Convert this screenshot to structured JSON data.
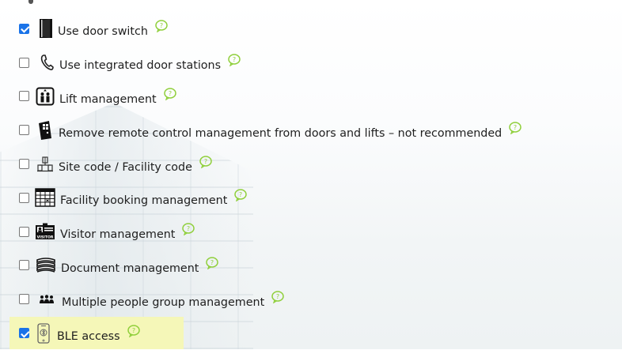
{
  "options": [
    {
      "label": "Use door switch",
      "checked": true,
      "icon": "door-switch-icon"
    },
    {
      "label": "Use integrated door stations",
      "checked": false,
      "icon": "phone-icon"
    },
    {
      "label": "Lift management",
      "checked": false,
      "icon": "lift-icon"
    },
    {
      "label": "Remove remote control management from doors and lifts – not recommended",
      "checked": false,
      "icon": "remote-door-icon"
    },
    {
      "label": "Site code / Facility code",
      "checked": false,
      "icon": "site-code-icon"
    },
    {
      "label": "Facility booking management",
      "checked": false,
      "icon": "calendar-icon"
    },
    {
      "label": "Visitor management",
      "checked": false,
      "icon": "visitor-badge-icon",
      "icon_text": "VISITOR"
    },
    {
      "label": "Document management",
      "checked": false,
      "icon": "documents-icon"
    },
    {
      "label": "Multiple people group management",
      "checked": false,
      "icon": "people-group-icon"
    },
    {
      "label": "BLE access",
      "checked": true,
      "icon": "ble-phone-icon",
      "highlighted": true
    }
  ],
  "colors": {
    "help_icon": "#8fcf3a",
    "highlight": "#f5f7b8",
    "checkbox_checked": "#1a73e8"
  }
}
